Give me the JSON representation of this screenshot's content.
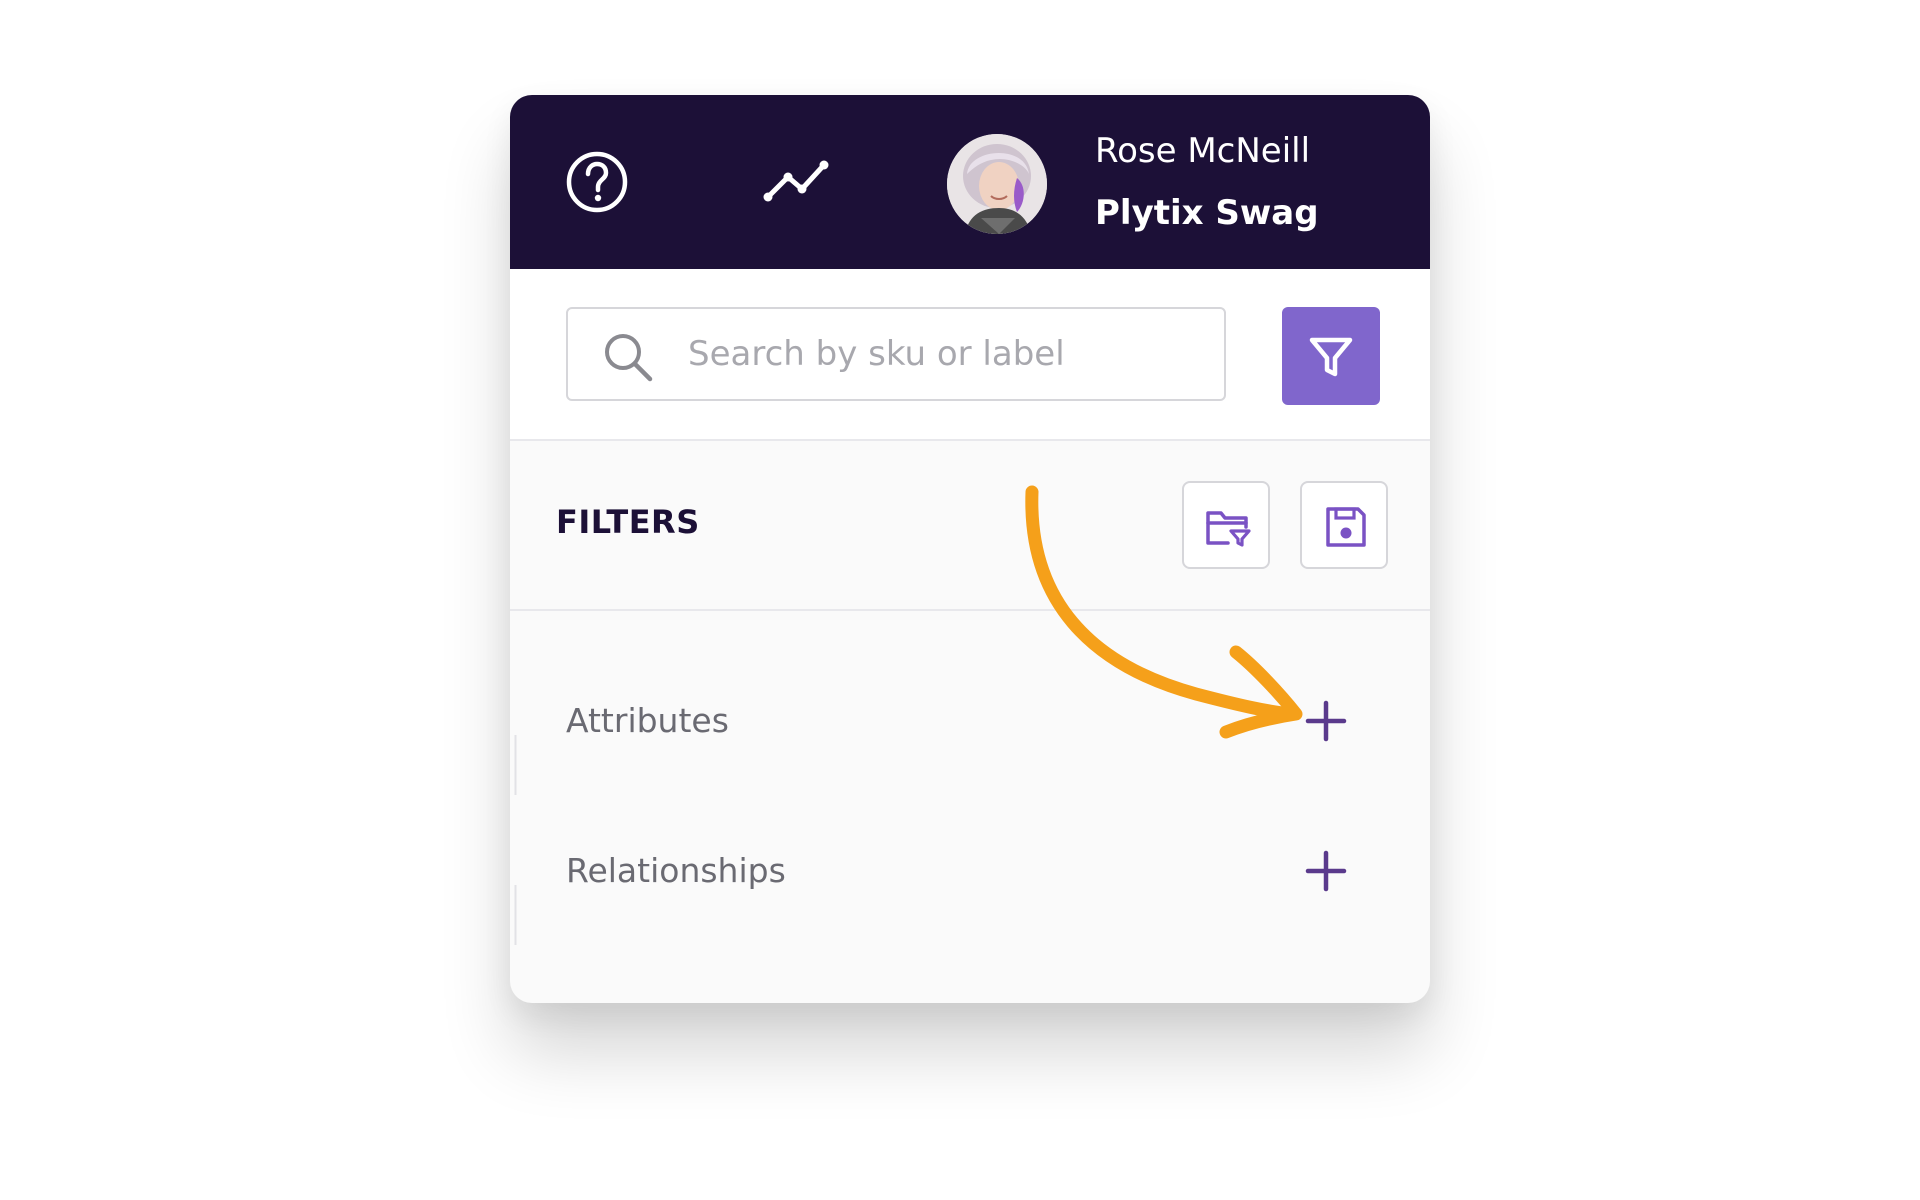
{
  "header": {
    "user_name": "Rose McNeill",
    "company_name": "Plytix Swag",
    "icons": [
      "help-icon",
      "analytics-icon",
      "avatar"
    ]
  },
  "search": {
    "placeholder": "Search by sku or label",
    "value": ""
  },
  "filters": {
    "title": "FILTERS",
    "items": [
      {
        "label": "Attributes"
      },
      {
        "label": "Relationships"
      }
    ]
  },
  "colors": {
    "header_bg": "#1c1037",
    "accent": "#8066cc",
    "plus": "#5a3a8c",
    "annotation_arrow": "#f5a01a"
  }
}
